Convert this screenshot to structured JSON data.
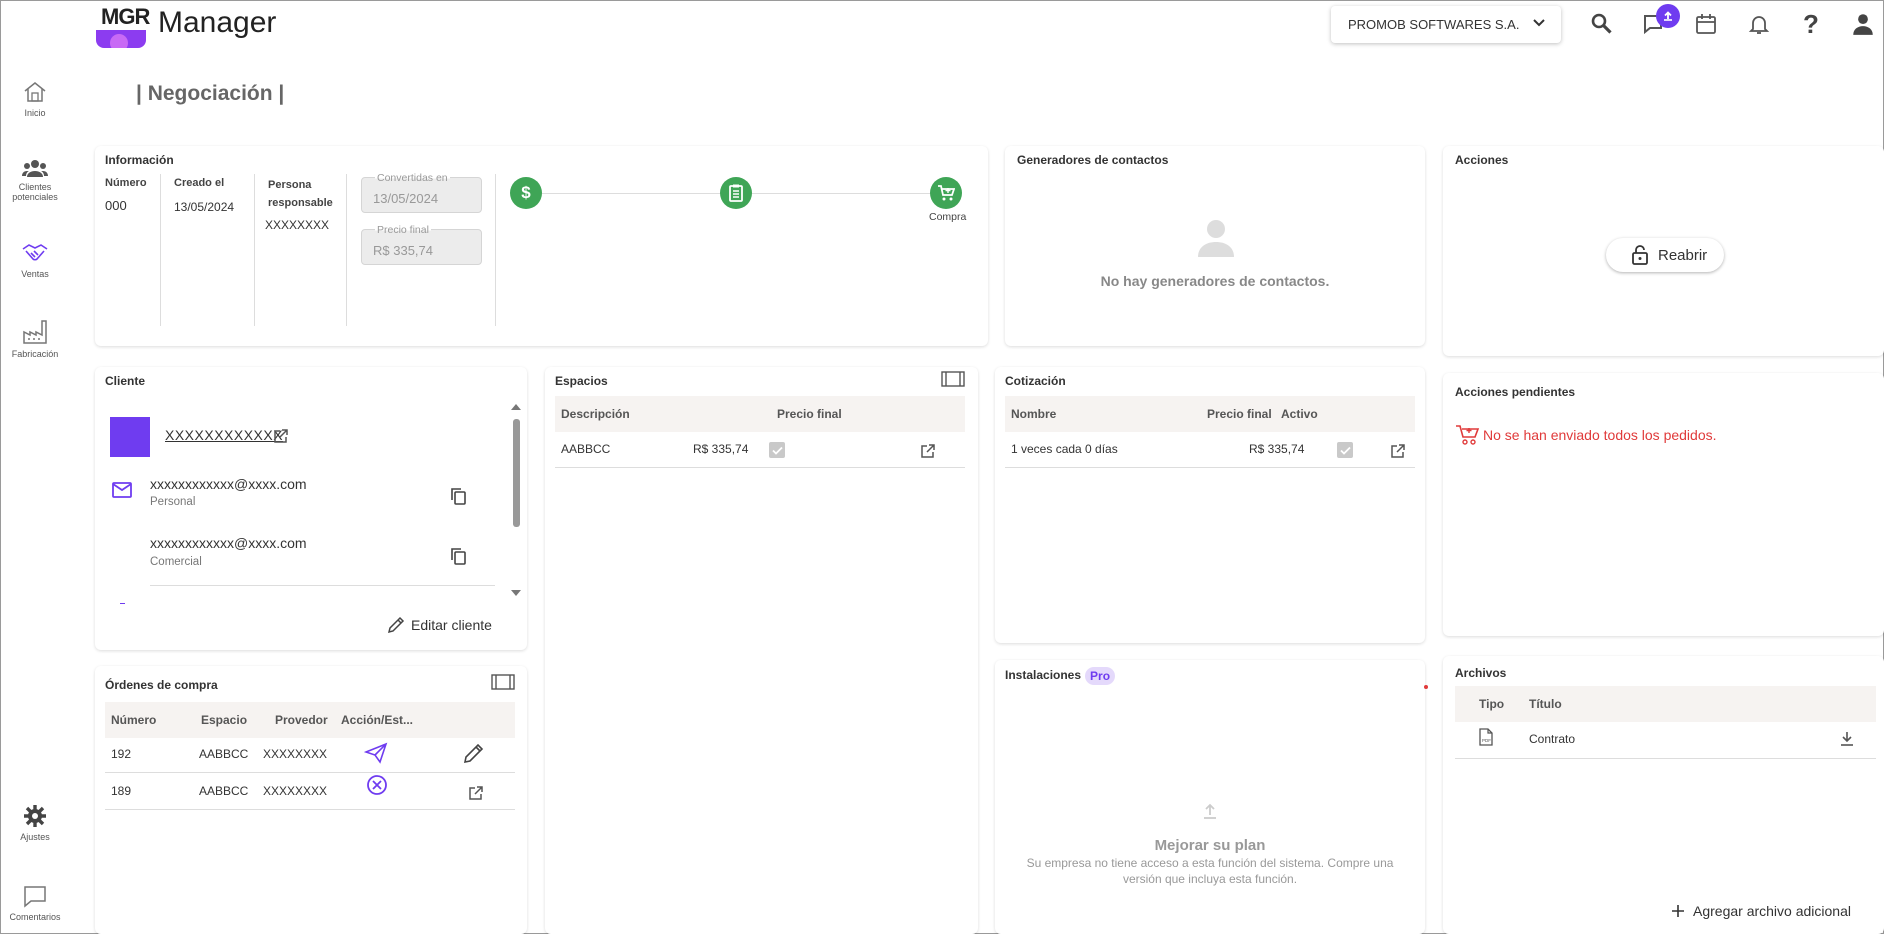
{
  "app": {
    "logo_text": "MGR",
    "title": "Manager"
  },
  "header": {
    "company": "PROMOB SOFTWARES S.A."
  },
  "sidebar": {
    "items": [
      {
        "label": "Inicio"
      },
      {
        "label": "Clientes potenciales"
      },
      {
        "label": "Ventas"
      },
      {
        "label": "Fabricación"
      },
      {
        "label": "Ajustes"
      },
      {
        "label": "Comentarios"
      }
    ]
  },
  "page": {
    "title": "| Negociación |"
  },
  "informacion": {
    "title": "Información",
    "numero_label": "Número",
    "numero_value": "000",
    "creado_label": "Creado el",
    "creado_value": "13/05/2024",
    "persona_label": "Persona responsable",
    "persona_value": "XXXXXXXX",
    "convertidas_label": "Convertidas en",
    "convertidas_value": "13/05/2024",
    "precio_label": "Precio final",
    "precio_value": "R$ 335,74",
    "step_last_label": "Compra"
  },
  "generadores": {
    "title": "Generadores de contactos",
    "empty": "No hay generadores de contactos."
  },
  "acciones": {
    "title": "Acciones",
    "reabrir": "Reabrir"
  },
  "cliente": {
    "title": "Cliente",
    "name": "XXXXXXXXXXXX",
    "emails": [
      {
        "email": "xxxxxxxxxxxx@xxxx.com",
        "type": "Personal"
      },
      {
        "email": "xxxxxxxxxxxx@xxxx.com",
        "type": "Comercial"
      }
    ],
    "edit": "Editar cliente"
  },
  "espacios": {
    "title": "Espacios",
    "headers": [
      "Descripción",
      "Precio final"
    ],
    "rows": [
      {
        "descripcion": "AABBCC",
        "precio": "R$ 335,74"
      }
    ]
  },
  "cotizacion": {
    "title": "Cotización",
    "headers": [
      "Nombre",
      "Precio final",
      "Activo"
    ],
    "rows": [
      {
        "nombre": "1 veces cada 0 días",
        "precio": "R$ 335,74"
      }
    ]
  },
  "pendientes": {
    "title": "Acciones pendientes",
    "message": "No se han enviado todos los pedidos."
  },
  "ordenes": {
    "title": "Órdenes de compra",
    "headers": [
      "Número",
      "Espacio",
      "Provedor",
      "Acción/Est..."
    ],
    "rows": [
      {
        "numero": "192",
        "espacio": "AABBCC",
        "proveedor": "XXXXXXXX"
      },
      {
        "numero": "189",
        "espacio": "AABBCC",
        "proveedor": "XXXXXXXX"
      }
    ]
  },
  "instalaciones": {
    "title": "Instalaciones",
    "badge": "Pro",
    "upgrade_title": "Mejorar su plan",
    "upgrade_text": "Su empresa no tiene acceso a esta función del sistema. Compre una versión que incluya esta función."
  },
  "archivos": {
    "title": "Archivos",
    "headers": [
      "Tipo",
      "Título"
    ],
    "rows": [
      {
        "titulo": "Contrato"
      }
    ],
    "add": "Agregar archivo adicional"
  },
  "colors": {
    "accent": "#6f3cf0",
    "success": "#3fa556",
    "danger": "#e03a3a"
  }
}
